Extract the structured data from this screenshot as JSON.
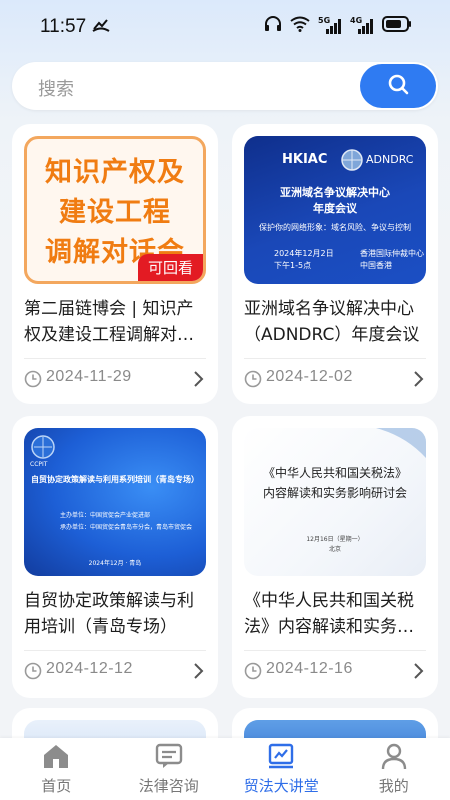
{
  "status_bar": {
    "time": "11:57",
    "network_labels": [
      "5G",
      "4G"
    ]
  },
  "search": {
    "placeholder": "搜索",
    "button_icon": "search-icon"
  },
  "colors": {
    "accent": "#2f7bf2",
    "active_nav": "#2f6ee8",
    "replay_badge": "#e31b23"
  },
  "cards": [
    {
      "title": "第二届链博会 | 知识产权及建设工程调解对话会",
      "date": "2024-11-29",
      "image_text": [
        "知识产权及",
        "建设工程",
        "调解对话会"
      ],
      "badge": "可回看"
    },
    {
      "title": "亚洲域名争议解决中心（ADNDRC）年度会议",
      "date": "2024-12-02",
      "image_text": {
        "logo_left": "HKIAC",
        "logo_right": "ADNDRC",
        "heading": "亚洲域名争议解决中心",
        "subheading": "年度会议",
        "tagline": "保护你的网络形象：域名风险、争议与控制",
        "when_1": "2024年12月2日",
        "when_2": "下午1-5点",
        "where_1": "香港国际仲裁中心",
        "where_2": "中国香港"
      }
    },
    {
      "title": "自贸协定政策解读与利用培训（青岛专场）",
      "date": "2024-12-12",
      "image_text": {
        "logo": "CCPIT",
        "heading": "自贸协定政策解读与利用系列培训（青岛专场）",
        "line1": "主办单位：中国贸促会产业促进部",
        "line2": "承办单位：中国贸促会青岛市分会，青岛市贸促会",
        "footer": "2024年12月 · 青岛"
      }
    },
    {
      "title": "《中华人民共和国关税法》内容解读和实务影响研讨会",
      "date": "2024-12-16",
      "image_text": {
        "line1": "《中华人民共和国关税法》",
        "line2": "内容解读和实务影响研讨会",
        "date_line": "12月16日（星期一）",
        "place": "北京"
      }
    }
  ],
  "bottom_nav": [
    {
      "label": "首页",
      "icon": "home-icon"
    },
    {
      "label": "法律咨询",
      "icon": "chat-icon"
    },
    {
      "label": "贸法大讲堂",
      "icon": "lecture-icon",
      "active": true
    },
    {
      "label": "我的",
      "icon": "user-icon"
    }
  ]
}
